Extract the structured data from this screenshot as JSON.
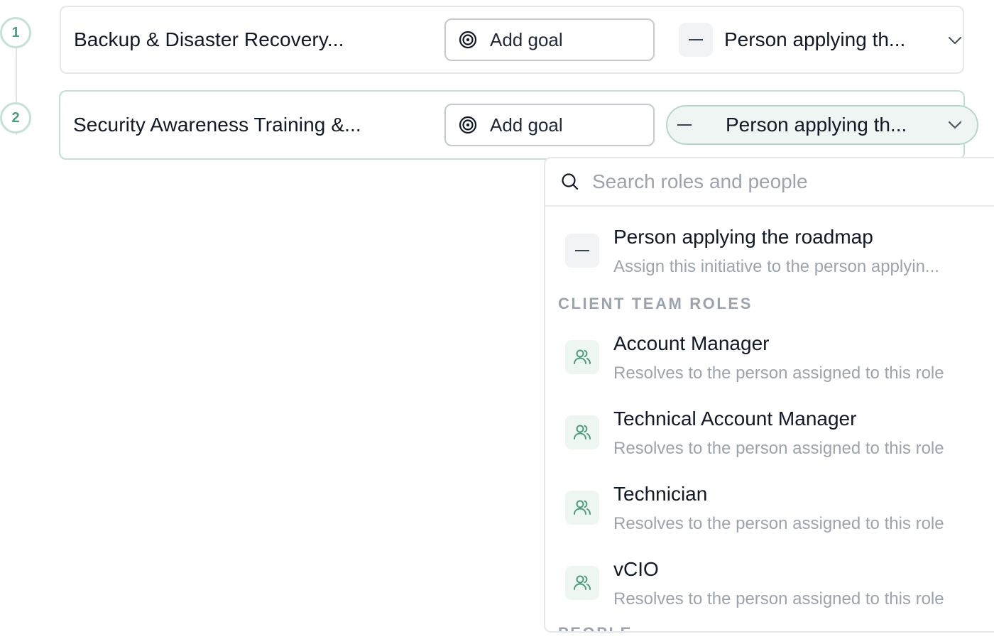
{
  "steps": [
    {
      "number": "1",
      "title": "Backup & Disaster Recovery...",
      "goal_label": "Add goal",
      "assignee_label": "Person applying th..."
    },
    {
      "number": "2",
      "title": "Security Awareness Training &...",
      "goal_label": "Add goal",
      "assignee_label": "Person applying th..."
    }
  ],
  "dropdown": {
    "search_placeholder": "Search roles and people",
    "default_option": {
      "title": "Person applying the roadmap",
      "description": "Assign this initiative to the person applyin..."
    },
    "client_team_section": "CLIENT TEAM ROLES",
    "roles": [
      {
        "title": "Account Manager",
        "description": "Resolves to the person assigned to this role"
      },
      {
        "title": "Technical Account Manager",
        "description": "Resolves to the person assigned to this role"
      },
      {
        "title": "Technician",
        "description": "Resolves to the person assigned to this role"
      },
      {
        "title": "vCIO",
        "description": "Resolves to the person assigned to this role"
      }
    ],
    "people_section": "PEOPLE"
  },
  "colors": {
    "accent_green": "#4a9d7c",
    "step_border": "#c3e2d5",
    "open_pill_bg": "#eef5f2"
  },
  "icons": {
    "goal": "target-icon",
    "assignee": "dash-icon",
    "chevron": "chevron-down-icon",
    "search": "search-icon",
    "role": "users-icon"
  }
}
